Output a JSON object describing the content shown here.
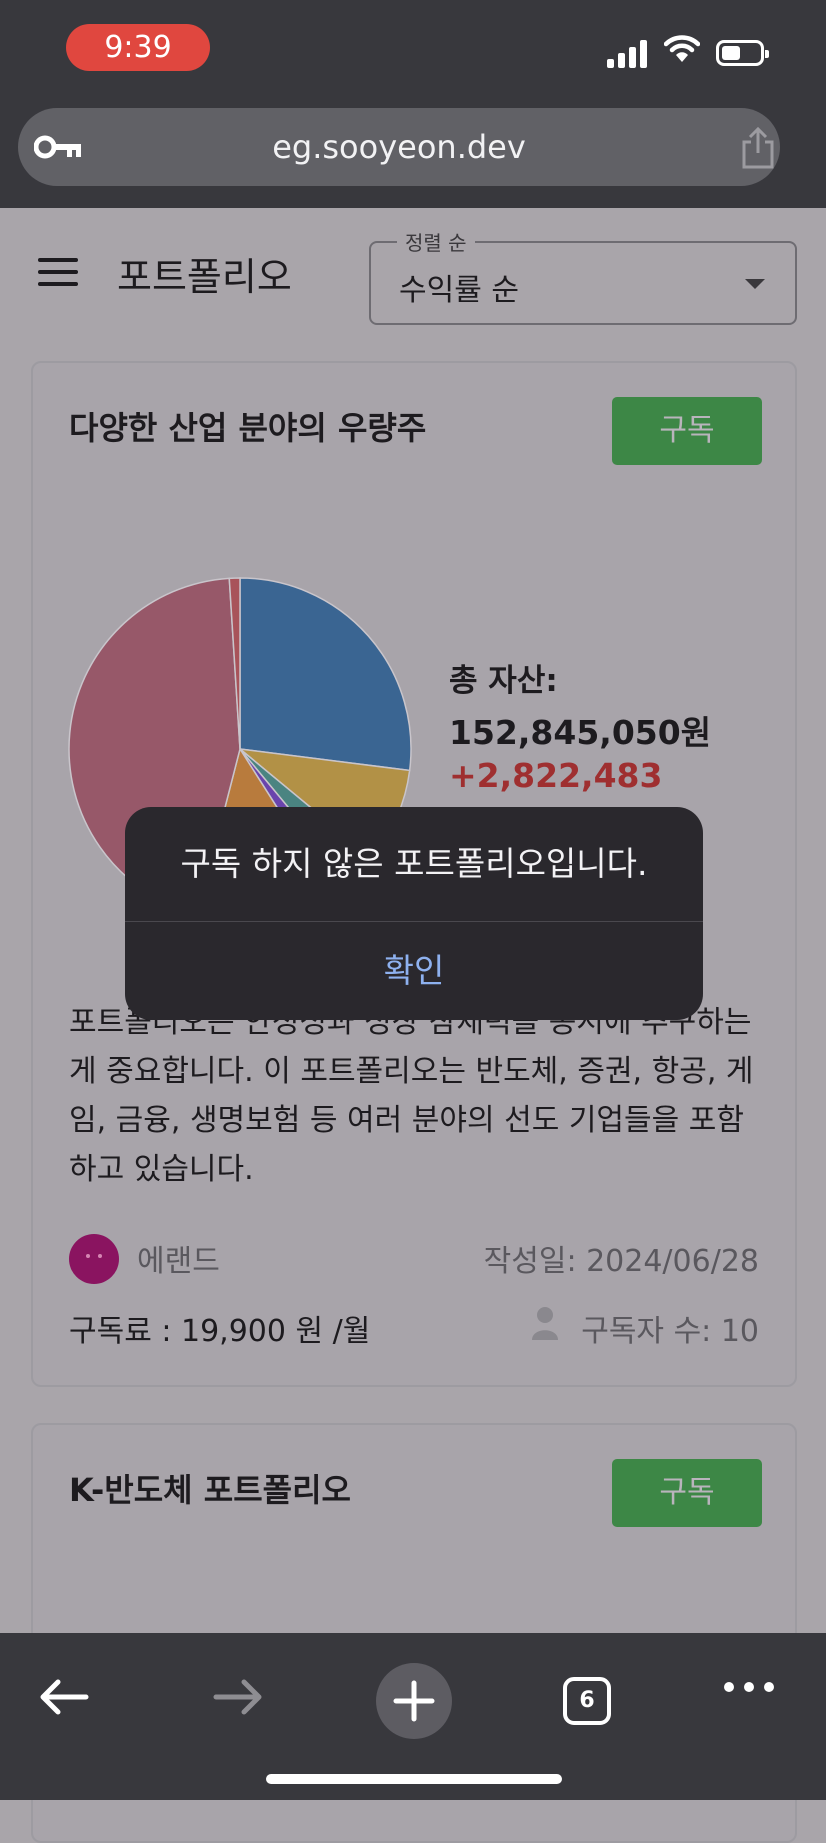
{
  "status_bar": {
    "time": "9:39"
  },
  "browser": {
    "url": "eg.sooyeon.dev",
    "tabs_count": "6"
  },
  "header": {
    "title": "포트폴리오",
    "sort_label": "정렬 순",
    "sort_value": "수익률 순"
  },
  "portfolios": [
    {
      "title": "다양한 산업 분야의 우량주",
      "subscribe_label": "구독",
      "total_label": "총 자산:",
      "total_value": "152,845,050원",
      "change": "+2,822,483",
      "description": "포트폴리오는 안정성과 성장 잠재력을 동시에 추구하는게 중요합니다. 이 포트폴리오는 반도체, 증권, 항공, 게임, 금융, 생명보험 등 여러 분야의 선도 기업들을 포함하고 있습니다.",
      "author": "에랜드",
      "created": "작성일: 2024/06/28",
      "fee": "구독료 : 19,900 원 /월",
      "subscribers": "구독자 수: 10"
    },
    {
      "title": "K-반도체 포트폴리오",
      "subscribe_label": "구독"
    }
  ],
  "chart_data": {
    "type": "pie",
    "values": [
      27,
      9,
      3,
      2,
      13,
      45,
      1
    ],
    "colors": [
      "#3a6592",
      "#b29146",
      "#4a8481",
      "#6a44ad",
      "#b87b3d",
      "#975869",
      "#a8535a"
    ]
  },
  "dialog": {
    "message": "구독 하지 않은 포트폴리오입니다.",
    "confirm_label": "확인"
  }
}
